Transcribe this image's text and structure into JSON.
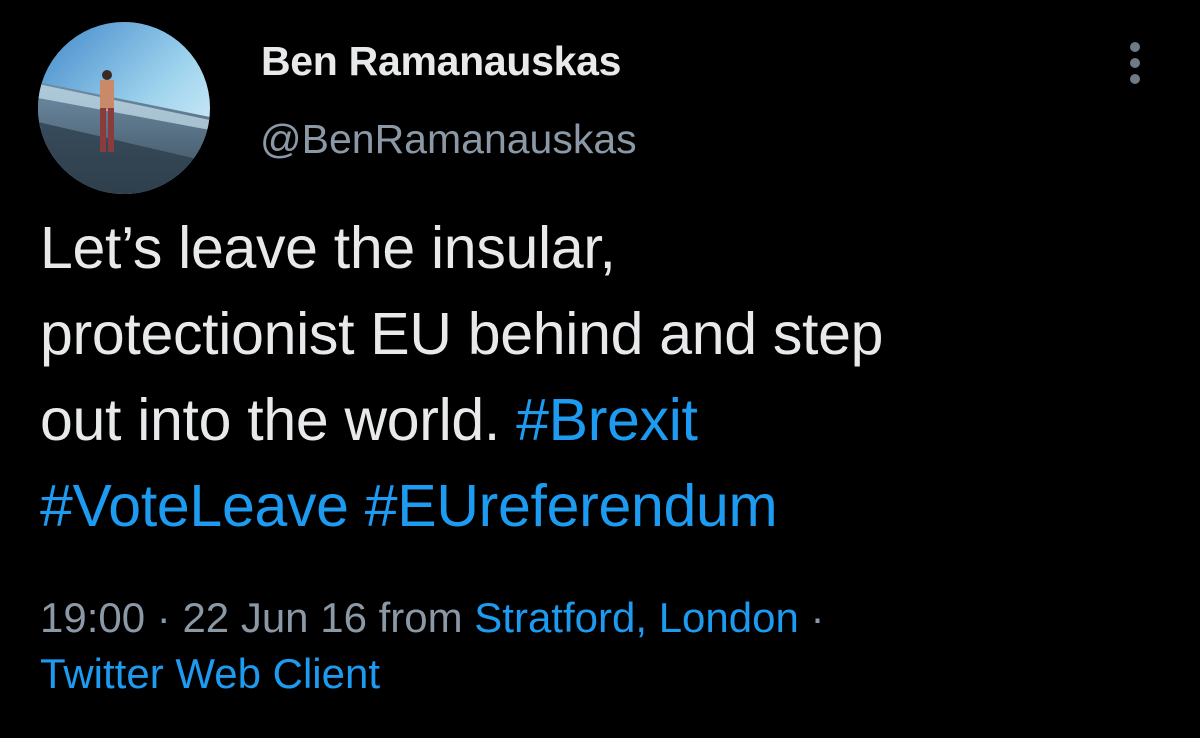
{
  "author": {
    "name": "Ben Ramanauskas",
    "handle": "@BenRamanauskas"
  },
  "tweet": {
    "line1": "Let’s leave the insular,",
    "line2": "protectionist EU behind and step",
    "line3_text": "out into the world. ",
    "hashtags": [
      "#Brexit",
      "#VoteLeave",
      "#EUreferendum"
    ]
  },
  "meta": {
    "time": "19:00",
    "separator": " · ",
    "date": "22 Jun 16",
    "from": " from ",
    "location": "Stratford, London",
    "separator_end": " ·",
    "client": "Twitter Web Client"
  },
  "icons": {
    "more": "more-vertical-icon"
  },
  "colors": {
    "background": "#000000",
    "text": "#e7e9ea",
    "secondary": "#8b98a5",
    "link": "#1d9bf0"
  }
}
